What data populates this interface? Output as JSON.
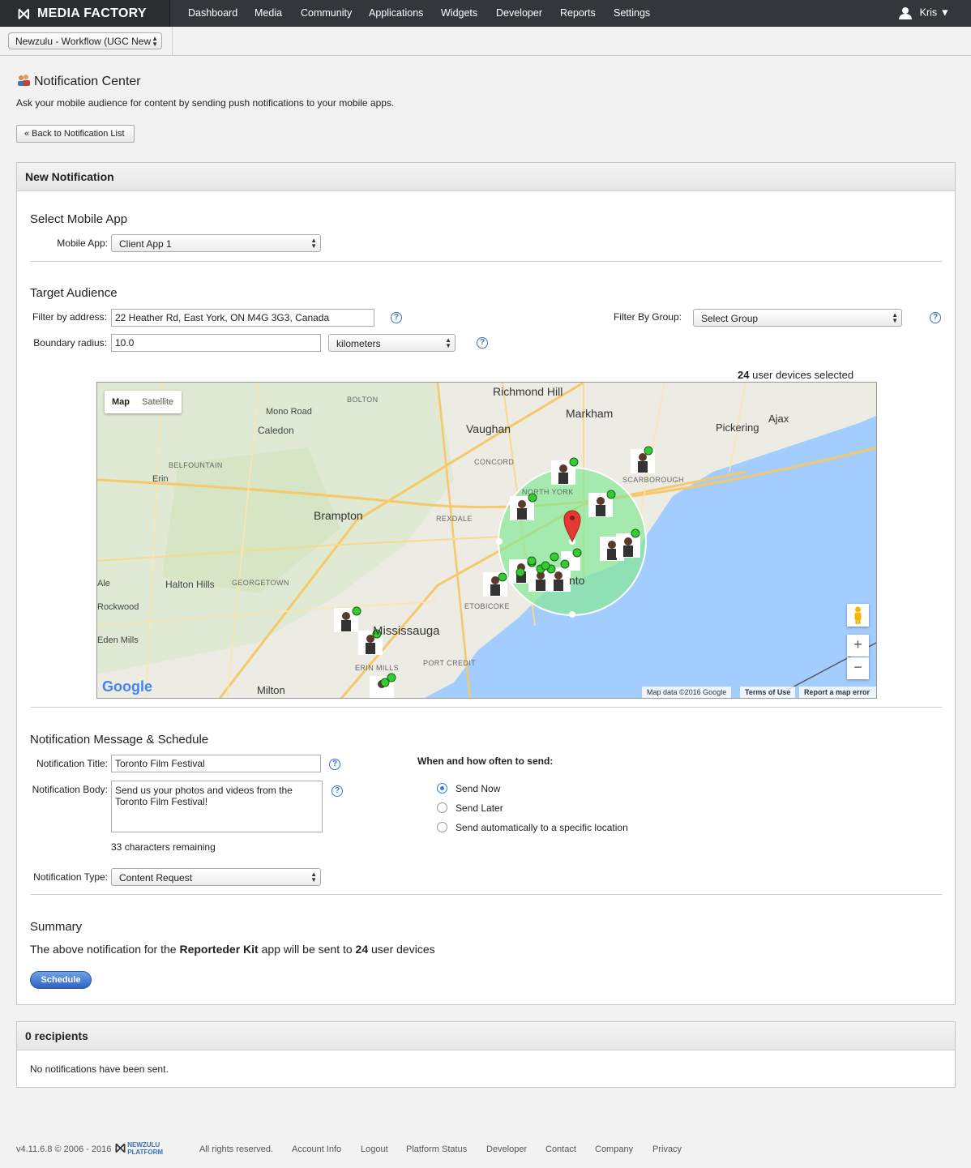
{
  "brand": {
    "name": "MEDIA FACTORY"
  },
  "nav": {
    "items": [
      "Dashboard",
      "Media",
      "Community",
      "Applications",
      "Widgets",
      "Developer",
      "Reports",
      "Settings"
    ],
    "user": "Kris"
  },
  "workflow_select": "Newzulu - Workflow (UGC New",
  "page": {
    "title": "Notification Center",
    "description": "Ask your mobile audience for content by sending push notifications to your mobile apps.",
    "back_button": "« Back to Notification List"
  },
  "panel": {
    "title": "New Notification",
    "select_app": {
      "heading": "Select Mobile App",
      "label": "Mobile App:",
      "value": "Client App 1"
    },
    "target": {
      "heading": "Target Audience",
      "address_label": "Filter by address:",
      "address_value": "22 Heather Rd, East York, ON M4G 3G3, Canada",
      "group_label": "Filter By Group:",
      "group_value": "Select Group",
      "radius_label": "Boundary radius:",
      "radius_value": "10.0",
      "unit_value": "kilometers",
      "selected_count": "24",
      "selected_suffix": "user devices selected"
    },
    "map": {
      "tab_map": "Map",
      "tab_satellite": "Satellite",
      "labels": {
        "richmond_hill": "Richmond Hill",
        "markham": "Markham",
        "vaughan": "Vaughan",
        "pickering": "Pickering",
        "ajax": "Ajax",
        "brampton": "Brampton",
        "mississauga": "Mississauga",
        "milton": "Milton",
        "halton_hills": "Halton Hills",
        "caledon": "Caledon",
        "mono_road": "Mono Road",
        "erin": "Erin",
        "rockwood": "Rockwood",
        "eden_mills": "Eden Mills",
        "ale": "Ale",
        "toronto": "nto",
        "bolton": "BOLTON",
        "belfountain": "BELFOUNTAIN",
        "georgetown": "GEORGETOWN",
        "concord": "CONCORD",
        "north_york": "NORTH YORK",
        "scarborough": "SCARBOROUGH",
        "rexdale": "REXDALE",
        "etobicoke": "ETOBICOKE",
        "erin_mills": "ERIN MILLS",
        "port_credit": "PORT CREDIT"
      },
      "google": "Google",
      "map_data": "Map data ©2016 Google",
      "terms": "Terms of Use",
      "report": "Report a map error"
    },
    "message": {
      "heading": "Notification Message & Schedule",
      "title_label": "Notification Title:",
      "title_value": "Toronto Film Festival",
      "body_label": "Notification Body:",
      "body_value": "Send us your photos and videos from the Toronto Film Festival!",
      "remaining_count": "33",
      "remaining_suffix": "characters remaining",
      "type_label": "Notification Type:",
      "type_value": "Content Request",
      "when_label": "When and how often to send:",
      "options": [
        "Send Now",
        "Send Later",
        "Send automatically to a specific location"
      ],
      "selected_option": "Send Now"
    },
    "summary": {
      "heading": "Summary",
      "pre": "The above notification for the",
      "app_name": "Reporteder Kit",
      "mid": "app will be sent to",
      "count": "24",
      "post": "user devices",
      "button": "Schedule"
    }
  },
  "recipients": {
    "title": "0 recipients",
    "message": "No notifications have been sent."
  },
  "footer": {
    "version": "v4.11.6.8 © 2006 - 2016",
    "platform_logo": "NEWZULU PLATFORM",
    "rights": "All rights reserved.",
    "links": [
      "Account Info",
      "Logout",
      "Platform Status",
      "Developer",
      "Contact",
      "Company",
      "Privacy"
    ]
  },
  "colors": {
    "nav_bg": "#33363b",
    "primary_button": "#2f62c1",
    "map_water": "#a3ccff",
    "boundary_fill": "#86e896"
  }
}
